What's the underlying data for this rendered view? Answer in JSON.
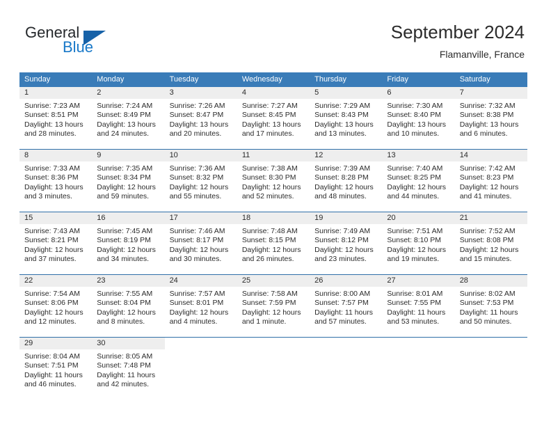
{
  "brand": {
    "name_part1": "General",
    "name_part2": "Blue",
    "accent_color": "#1878c8",
    "triangle_color": "#1762a8"
  },
  "header": {
    "title": "September 2024",
    "subtitle": "Flamanville, France"
  },
  "colors": {
    "header_row_bg": "#3a7cb8",
    "day_number_band": "#eeeeee",
    "week_separator": "#2f6fa8",
    "text": "#2b2b2b"
  },
  "weekdays": [
    "Sunday",
    "Monday",
    "Tuesday",
    "Wednesday",
    "Thursday",
    "Friday",
    "Saturday"
  ],
  "weeks": [
    [
      {
        "day": "1",
        "sunrise": "Sunrise: 7:23 AM",
        "sunset": "Sunset: 8:51 PM",
        "daylight1": "Daylight: 13 hours",
        "daylight2": "and 28 minutes."
      },
      {
        "day": "2",
        "sunrise": "Sunrise: 7:24 AM",
        "sunset": "Sunset: 8:49 PM",
        "daylight1": "Daylight: 13 hours",
        "daylight2": "and 24 minutes."
      },
      {
        "day": "3",
        "sunrise": "Sunrise: 7:26 AM",
        "sunset": "Sunset: 8:47 PM",
        "daylight1": "Daylight: 13 hours",
        "daylight2": "and 20 minutes."
      },
      {
        "day": "4",
        "sunrise": "Sunrise: 7:27 AM",
        "sunset": "Sunset: 8:45 PM",
        "daylight1": "Daylight: 13 hours",
        "daylight2": "and 17 minutes."
      },
      {
        "day": "5",
        "sunrise": "Sunrise: 7:29 AM",
        "sunset": "Sunset: 8:43 PM",
        "daylight1": "Daylight: 13 hours",
        "daylight2": "and 13 minutes."
      },
      {
        "day": "6",
        "sunrise": "Sunrise: 7:30 AM",
        "sunset": "Sunset: 8:40 PM",
        "daylight1": "Daylight: 13 hours",
        "daylight2": "and 10 minutes."
      },
      {
        "day": "7",
        "sunrise": "Sunrise: 7:32 AM",
        "sunset": "Sunset: 8:38 PM",
        "daylight1": "Daylight: 13 hours",
        "daylight2": "and 6 minutes."
      }
    ],
    [
      {
        "day": "8",
        "sunrise": "Sunrise: 7:33 AM",
        "sunset": "Sunset: 8:36 PM",
        "daylight1": "Daylight: 13 hours",
        "daylight2": "and 3 minutes."
      },
      {
        "day": "9",
        "sunrise": "Sunrise: 7:35 AM",
        "sunset": "Sunset: 8:34 PM",
        "daylight1": "Daylight: 12 hours",
        "daylight2": "and 59 minutes."
      },
      {
        "day": "10",
        "sunrise": "Sunrise: 7:36 AM",
        "sunset": "Sunset: 8:32 PM",
        "daylight1": "Daylight: 12 hours",
        "daylight2": "and 55 minutes."
      },
      {
        "day": "11",
        "sunrise": "Sunrise: 7:38 AM",
        "sunset": "Sunset: 8:30 PM",
        "daylight1": "Daylight: 12 hours",
        "daylight2": "and 52 minutes."
      },
      {
        "day": "12",
        "sunrise": "Sunrise: 7:39 AM",
        "sunset": "Sunset: 8:28 PM",
        "daylight1": "Daylight: 12 hours",
        "daylight2": "and 48 minutes."
      },
      {
        "day": "13",
        "sunrise": "Sunrise: 7:40 AM",
        "sunset": "Sunset: 8:25 PM",
        "daylight1": "Daylight: 12 hours",
        "daylight2": "and 44 minutes."
      },
      {
        "day": "14",
        "sunrise": "Sunrise: 7:42 AM",
        "sunset": "Sunset: 8:23 PM",
        "daylight1": "Daylight: 12 hours",
        "daylight2": "and 41 minutes."
      }
    ],
    [
      {
        "day": "15",
        "sunrise": "Sunrise: 7:43 AM",
        "sunset": "Sunset: 8:21 PM",
        "daylight1": "Daylight: 12 hours",
        "daylight2": "and 37 minutes."
      },
      {
        "day": "16",
        "sunrise": "Sunrise: 7:45 AM",
        "sunset": "Sunset: 8:19 PM",
        "daylight1": "Daylight: 12 hours",
        "daylight2": "and 34 minutes."
      },
      {
        "day": "17",
        "sunrise": "Sunrise: 7:46 AM",
        "sunset": "Sunset: 8:17 PM",
        "daylight1": "Daylight: 12 hours",
        "daylight2": "and 30 minutes."
      },
      {
        "day": "18",
        "sunrise": "Sunrise: 7:48 AM",
        "sunset": "Sunset: 8:15 PM",
        "daylight1": "Daylight: 12 hours",
        "daylight2": "and 26 minutes."
      },
      {
        "day": "19",
        "sunrise": "Sunrise: 7:49 AM",
        "sunset": "Sunset: 8:12 PM",
        "daylight1": "Daylight: 12 hours",
        "daylight2": "and 23 minutes."
      },
      {
        "day": "20",
        "sunrise": "Sunrise: 7:51 AM",
        "sunset": "Sunset: 8:10 PM",
        "daylight1": "Daylight: 12 hours",
        "daylight2": "and 19 minutes."
      },
      {
        "day": "21",
        "sunrise": "Sunrise: 7:52 AM",
        "sunset": "Sunset: 8:08 PM",
        "daylight1": "Daylight: 12 hours",
        "daylight2": "and 15 minutes."
      }
    ],
    [
      {
        "day": "22",
        "sunrise": "Sunrise: 7:54 AM",
        "sunset": "Sunset: 8:06 PM",
        "daylight1": "Daylight: 12 hours",
        "daylight2": "and 12 minutes."
      },
      {
        "day": "23",
        "sunrise": "Sunrise: 7:55 AM",
        "sunset": "Sunset: 8:04 PM",
        "daylight1": "Daylight: 12 hours",
        "daylight2": "and 8 minutes."
      },
      {
        "day": "24",
        "sunrise": "Sunrise: 7:57 AM",
        "sunset": "Sunset: 8:01 PM",
        "daylight1": "Daylight: 12 hours",
        "daylight2": "and 4 minutes."
      },
      {
        "day": "25",
        "sunrise": "Sunrise: 7:58 AM",
        "sunset": "Sunset: 7:59 PM",
        "daylight1": "Daylight: 12 hours",
        "daylight2": "and 1 minute."
      },
      {
        "day": "26",
        "sunrise": "Sunrise: 8:00 AM",
        "sunset": "Sunset: 7:57 PM",
        "daylight1": "Daylight: 11 hours",
        "daylight2": "and 57 minutes."
      },
      {
        "day": "27",
        "sunrise": "Sunrise: 8:01 AM",
        "sunset": "Sunset: 7:55 PM",
        "daylight1": "Daylight: 11 hours",
        "daylight2": "and 53 minutes."
      },
      {
        "day": "28",
        "sunrise": "Sunrise: 8:02 AM",
        "sunset": "Sunset: 7:53 PM",
        "daylight1": "Daylight: 11 hours",
        "daylight2": "and 50 minutes."
      }
    ],
    [
      {
        "day": "29",
        "sunrise": "Sunrise: 8:04 AM",
        "sunset": "Sunset: 7:51 PM",
        "daylight1": "Daylight: 11 hours",
        "daylight2": "and 46 minutes."
      },
      {
        "day": "30",
        "sunrise": "Sunrise: 8:05 AM",
        "sunset": "Sunset: 7:48 PM",
        "daylight1": "Daylight: 11 hours",
        "daylight2": "and 42 minutes."
      },
      {
        "day": "",
        "sunrise": "",
        "sunset": "",
        "daylight1": "",
        "daylight2": ""
      },
      {
        "day": "",
        "sunrise": "",
        "sunset": "",
        "daylight1": "",
        "daylight2": ""
      },
      {
        "day": "",
        "sunrise": "",
        "sunset": "",
        "daylight1": "",
        "daylight2": ""
      },
      {
        "day": "",
        "sunrise": "",
        "sunset": "",
        "daylight1": "",
        "daylight2": ""
      },
      {
        "day": "",
        "sunrise": "",
        "sunset": "",
        "daylight1": "",
        "daylight2": ""
      }
    ]
  ]
}
